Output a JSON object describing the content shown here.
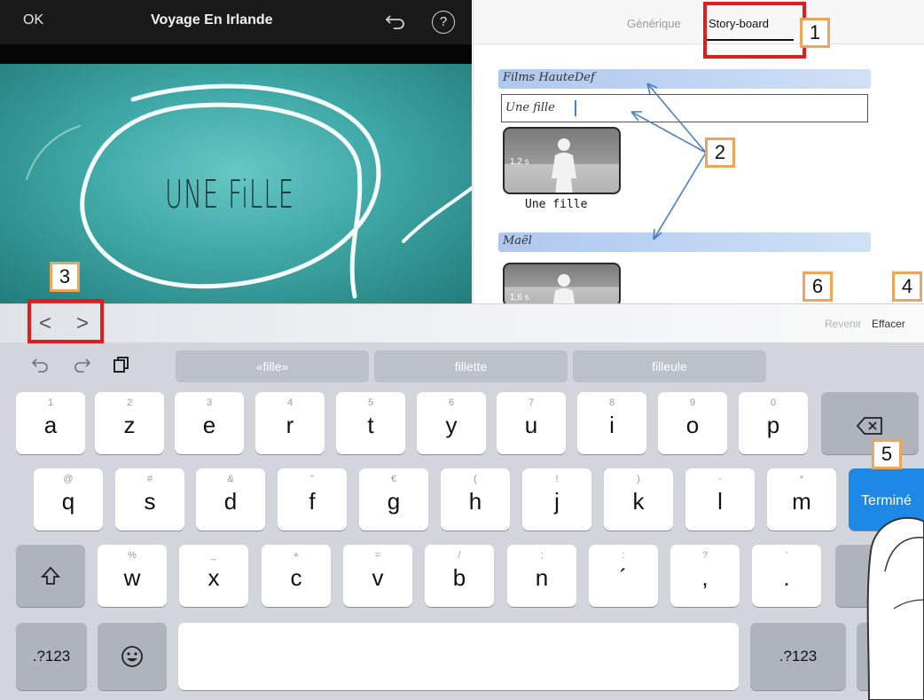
{
  "left": {
    "ok_label": "OK",
    "project_title": "Voyage En Irlande",
    "help_label": "?",
    "preview_title": "UNE FiLLE"
  },
  "right": {
    "tabs": [
      {
        "label": "Générique",
        "active": false
      },
      {
        "label": "Story-board",
        "active": true
      }
    ],
    "sections": [
      {
        "title": "Films HauteDef"
      },
      {
        "title": "Maël"
      }
    ],
    "title_field_value": "Une fille",
    "clips": [
      {
        "duration": "1,2 s",
        "label": "Une fille"
      },
      {
        "duration": "1,6 s",
        "label": ""
      }
    ]
  },
  "toolbar": {
    "prev_label": "<",
    "next_label": ">",
    "revenir_label": "Revenir",
    "effacer_label": "Effacer"
  },
  "keyboard": {
    "suggestions": [
      "«fille»",
      "fillette",
      "filleule"
    ],
    "row1": [
      {
        "hint": "1",
        "key": "a"
      },
      {
        "hint": "2",
        "key": "z"
      },
      {
        "hint": "3",
        "key": "e"
      },
      {
        "hint": "4",
        "key": "r"
      },
      {
        "hint": "5",
        "key": "t"
      },
      {
        "hint": "6",
        "key": "y"
      },
      {
        "hint": "7",
        "key": "u"
      },
      {
        "hint": "8",
        "key": "i"
      },
      {
        "hint": "9",
        "key": "o"
      },
      {
        "hint": "0",
        "key": "p"
      }
    ],
    "row2": [
      {
        "hint": "@",
        "key": "q"
      },
      {
        "hint": "#",
        "key": "s"
      },
      {
        "hint": "&",
        "key": "d"
      },
      {
        "hint": "\"",
        "key": "f"
      },
      {
        "hint": "€",
        "key": "g"
      },
      {
        "hint": "(",
        "key": "h"
      },
      {
        "hint": "!",
        "key": "j"
      },
      {
        "hint": ")",
        "key": "k"
      },
      {
        "hint": "-",
        "key": "l"
      },
      {
        "hint": "*",
        "key": "m"
      }
    ],
    "row3": [
      {
        "hint": "%",
        "key": "w"
      },
      {
        "hint": "_",
        "key": "x"
      },
      {
        "hint": "+",
        "key": "c"
      },
      {
        "hint": "=",
        "key": "v"
      },
      {
        "hint": "/",
        "key": "b"
      },
      {
        "hint": ";",
        "key": "n"
      },
      {
        "hint": ":",
        "key": "´"
      },
      {
        "hint": "?",
        "key": ","
      },
      {
        "hint": "’",
        "key": "."
      }
    ],
    "done_label": "Terminé",
    "numbers_label": ".?123"
  },
  "annotations": [
    "1",
    "2",
    "3",
    "4",
    "5",
    "6"
  ],
  "colors": {
    "annotation_border": "#f0a45a",
    "highlight_box": "#e21b1b",
    "done_key": "#1e88e6",
    "section_band": "#a9c4ec"
  }
}
